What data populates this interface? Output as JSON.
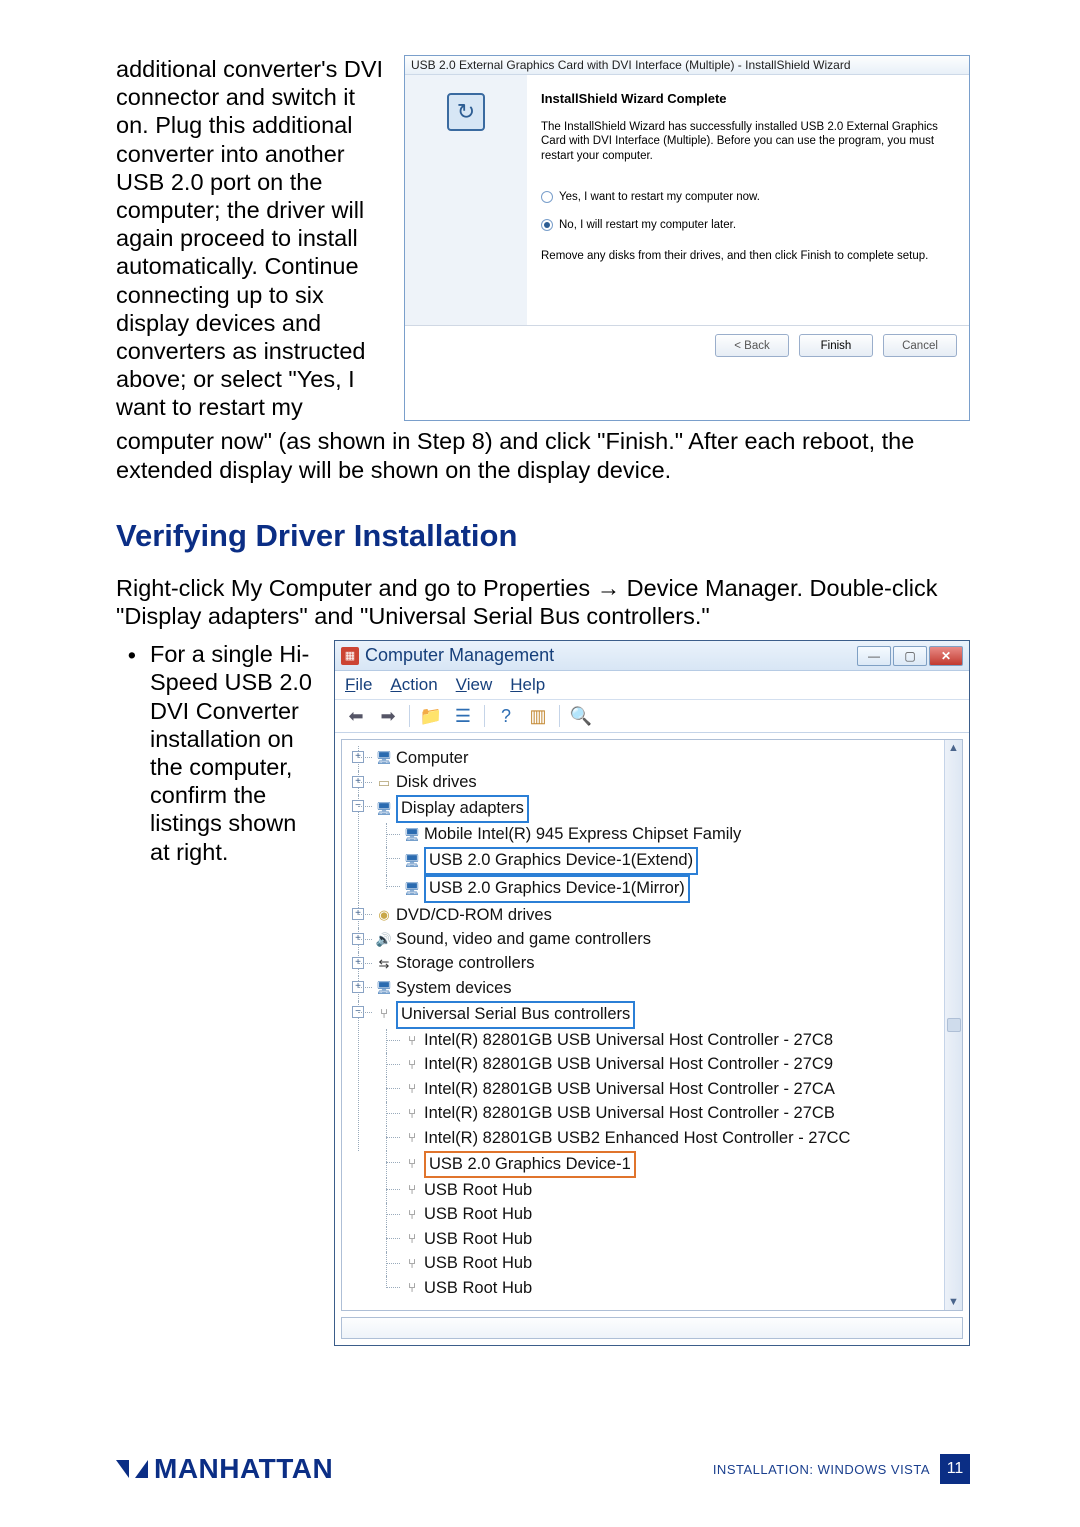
{
  "top_text_left": "additional converter's DVI connector and switch it on. Plug this additional converter into another USB 2.0 port on the computer; the driver will again proceed to install automatically. Continue connecting up to six display devices and converters as instructed above; or select \"Yes, I want to restart my",
  "after_text": "computer now\" (as shown in Step 8) and click \"Finish.\" After each reboot, the extended display will be shown on the display device.",
  "wizard": {
    "title": "USB 2.0 External Graphics Card with DVI Interface (Multiple) - InstallShield Wizard",
    "heading": "InstallShield Wizard Complete",
    "desc": "The InstallShield Wizard has successfully installed USB 2.0 External Graphics Card with DVI Interface (Multiple). Before you can use the program, you must restart your computer.",
    "opt_yes": "Yes, I want to restart my computer now.",
    "opt_no": "No, I will restart my computer later.",
    "note": "Remove any disks from their drives, and then click Finish to complete setup.",
    "btn_back": "< Back",
    "btn_finish": "Finish",
    "btn_cancel": "Cancel"
  },
  "heading": "Verifying Driver Installation",
  "body1": "Right-click My Computer and go to Properties → Device Manager. Double-click \"Display adapters\" and \"Universal Serial Bus controllers.\"",
  "bullet_text": "For a single Hi-Speed USB 2.0 DVI Converter installation on the computer, confirm the listings shown at right.",
  "cm": {
    "title": "Computer Management",
    "menu": {
      "file": "File",
      "action": "Action",
      "view": "View",
      "help": "Help"
    },
    "tree": {
      "computer": "Computer",
      "disk": "Disk drives",
      "display": "Display adapters",
      "display_children": [
        "Mobile Intel(R) 945 Express Chipset Family",
        "USB 2.0 Graphics Device-1(Extend)",
        "USB 2.0 Graphics Device-1(Mirror)"
      ],
      "dvd": "DVD/CD-ROM drives",
      "sound": "Sound, video and game controllers",
      "storage": "Storage controllers",
      "system": "System devices",
      "usb": "Universal Serial Bus controllers",
      "usb_children": [
        "Intel(R) 82801GB USB Universal Host Controller - 27C8",
        "Intel(R) 82801GB USB Universal Host Controller - 27C9",
        "Intel(R) 82801GB USB Universal Host Controller - 27CA",
        "Intel(R) 82801GB USB Universal Host Controller - 27CB",
        "Intel(R) 82801GB USB2 Enhanced Host Controller - 27CC",
        "USB 2.0 Graphics Device-1",
        "USB Root Hub",
        "USB Root Hub",
        "USB Root Hub",
        "USB Root Hub",
        "USB Root Hub"
      ]
    }
  },
  "footer": {
    "brand": "MANHATTAN",
    "section": "INSTALLATION: WINDOWS VISTA",
    "page": "11"
  }
}
